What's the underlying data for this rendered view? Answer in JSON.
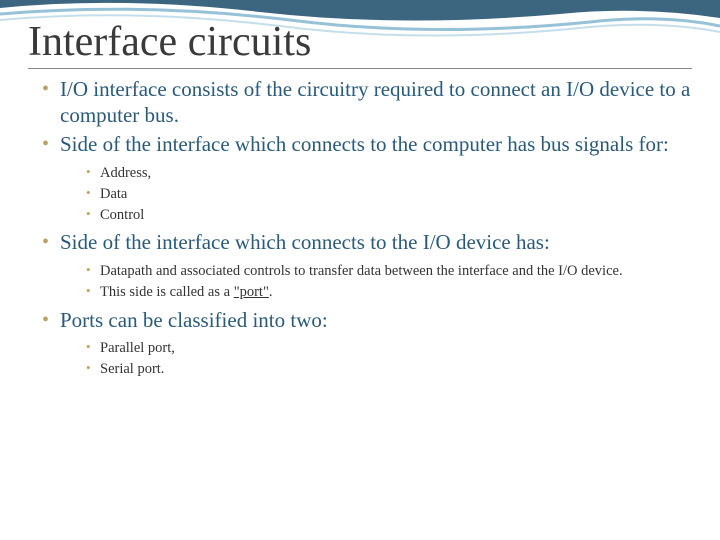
{
  "title": "Interface circuits",
  "bullets": {
    "b1": "I/O interface consists of the circuitry required to connect an I/O device to a computer bus.",
    "b2": "Side of the interface which connects to the computer has bus signals for:",
    "b2_sub": {
      "s1": "Address,",
      "s2": "Data",
      "s3": "Control"
    },
    "b3": "Side of the interface which connects to the I/O device has:",
    "b3_sub": {
      "s1": "Datapath and associated controls to transfer data between the interface and the I/O device.",
      "s2_pre": "This side is called as a ",
      "s2_link": "\"port\"",
      "s2_post": "."
    },
    "b4": "Ports can be classified into two:",
    "b4_sub": {
      "s1": "Parallel port,",
      "s2": "Serial port."
    }
  }
}
